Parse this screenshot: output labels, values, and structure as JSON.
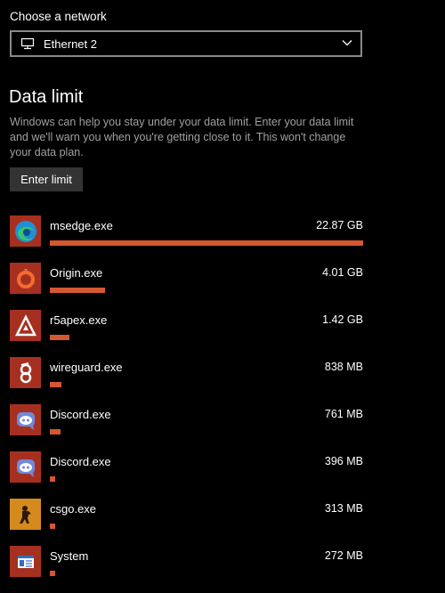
{
  "network": {
    "label": "Choose a network",
    "selected": "Ethernet 2"
  },
  "data_limit": {
    "title": "Data limit",
    "description": "Windows can help you stay under your data limit. Enter your data limit and we'll warn you when you're getting close to it. This won't change your data plan.",
    "button_label": "Enter limit"
  },
  "colors": {
    "bar": "#d5572f",
    "icon_bg": "#a63020"
  },
  "apps": [
    {
      "name": "msedge.exe",
      "size": "22.87 GB",
      "usage_fraction": 1.0,
      "icon": "edge-icon"
    },
    {
      "name": "Origin.exe",
      "size": "4.01 GB",
      "usage_fraction": 0.175,
      "icon": "origin-icon"
    },
    {
      "name": "r5apex.exe",
      "size": "1.42 GB",
      "usage_fraction": 0.062,
      "icon": "apex-icon"
    },
    {
      "name": "wireguard.exe",
      "size": "838 MB",
      "usage_fraction": 0.036,
      "icon": "wireguard-icon"
    },
    {
      "name": "Discord.exe",
      "size": "761 MB",
      "usage_fraction": 0.033,
      "icon": "discord-icon"
    },
    {
      "name": "Discord.exe",
      "size": "396 MB",
      "usage_fraction": 0.017,
      "icon": "discord-icon"
    },
    {
      "name": "csgo.exe",
      "size": "313 MB",
      "usage_fraction": 0.014,
      "icon": "csgo-icon"
    },
    {
      "name": "System",
      "size": "272 MB",
      "usage_fraction": 0.012,
      "icon": "system-icon"
    }
  ]
}
